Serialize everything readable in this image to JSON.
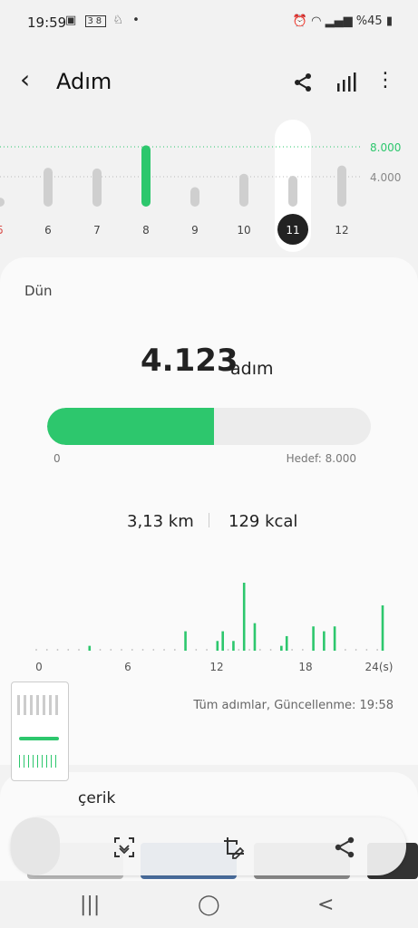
{
  "status_bar": {
    "time": "19:59",
    "notification_icons": [
      "image-icon",
      "calendar-icon",
      "badge-icon",
      "dot-icon"
    ],
    "notif_text": "38",
    "battery": "%45"
  },
  "header": {
    "title": "Adım"
  },
  "week_chart": {
    "labels": [
      "5",
      "6",
      "7",
      "8",
      "9",
      "10",
      "11",
      "12"
    ],
    "values": [
      1200,
      5200,
      5100,
      8200,
      2600,
      4400,
      4123,
      5500
    ],
    "selected": "11",
    "goal_line_label": "8.000",
    "mid_line_label": "4.000",
    "accent": "#2dc76d",
    "goal_met_color": "#2dc76d",
    "bar_color": "#cfcfcf"
  },
  "summary": {
    "day_label": "Dün",
    "steps": "4.123",
    "steps_unit": "adım",
    "progress_fraction": 0.515,
    "progress_min": "0",
    "goal_text": "Hedef: 8.000",
    "distance": "3,13 km",
    "calories": "129 kcal"
  },
  "hourly_chart": {
    "ticks": [
      "0",
      "6",
      "12",
      "18",
      "24(s)"
    ],
    "values": [
      0,
      0,
      0,
      0,
      0,
      0,
      0,
      0,
      0,
      0,
      30,
      0,
      0,
      0,
      0,
      0,
      0,
      0,
      0,
      0,
      0,
      0,
      0,
      0,
      0,
      0,
      0,
      0,
      120,
      0,
      0,
      0,
      0,
      0,
      60,
      120,
      0,
      60,
      0,
      420,
      0,
      170,
      0,
      0,
      0,
      0,
      30,
      90,
      0,
      0,
      0,
      0,
      150,
      0,
      120,
      0,
      150,
      0,
      0,
      0,
      0,
      0,
      0,
      0,
      0,
      280
    ],
    "color": "#2dc76d",
    "footer": "Tüm adımlar, Güncellenme: 19:58"
  },
  "content_section": {
    "title": "çerik"
  },
  "toolbar": {
    "icons": [
      "capture-icon",
      "crop-edit-icon",
      "share-icon"
    ]
  },
  "navbar": {
    "recents": "|||",
    "home": "◯",
    "back": "<"
  }
}
